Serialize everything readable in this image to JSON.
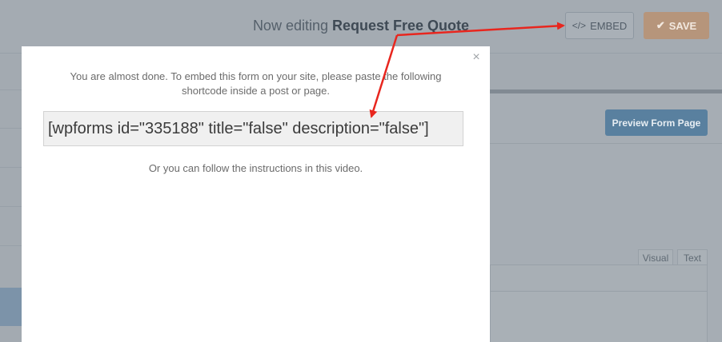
{
  "header": {
    "editing_prefix": "Now editing",
    "form_name": "Request Free Quote",
    "embed_label": "EMBED",
    "save_label": "SAVE"
  },
  "background": {
    "preview_label": "Preview Form Page",
    "tabs": [
      "Visual",
      "Text"
    ]
  },
  "modal": {
    "intro_line1": "You are almost done. To embed this form on your site, please paste the following",
    "intro_line2": "shortcode inside a post or page.",
    "shortcode": "[wpforms id=\"335188\" title=\"false\" description=\"false\"]",
    "followup": "Or you can follow the instructions in this video.",
    "close_glyph": "×"
  },
  "colors": {
    "annotation_arrow": "#e8261e",
    "overlay": "#a6adb4",
    "save_button": "#b6957b",
    "preview_button": "#59809f"
  }
}
